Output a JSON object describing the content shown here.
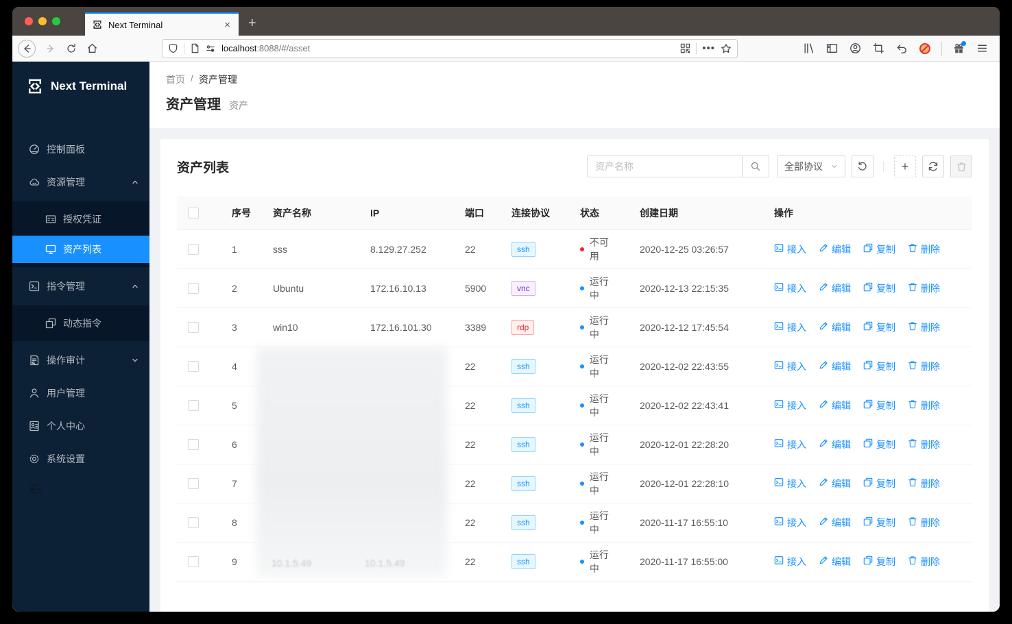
{
  "browser": {
    "tab_title": "Next Terminal",
    "url_host": "localhost",
    "url_rest": ":8088/#/asset",
    "new_tab_label": "+",
    "close_tab_label": "×"
  },
  "sidebar": {
    "logo_text": "Next Terminal",
    "items": [
      {
        "label": "控制面板",
        "icon": "dashboard"
      },
      {
        "label": "资源管理",
        "icon": "cloud",
        "caret": "up"
      },
      {
        "label": "授权凭证",
        "icon": "idcard",
        "submenu": true
      },
      {
        "label": "资产列表",
        "icon": "desktop",
        "submenu": true,
        "selected": true
      },
      {
        "label": "指令管理",
        "icon": "code",
        "caret": "up"
      },
      {
        "label": "动态指令",
        "icon": "block",
        "submenu": true
      },
      {
        "label": "操作审计",
        "icon": "audit",
        "caret": "down"
      },
      {
        "label": "用户管理",
        "icon": "user"
      },
      {
        "label": "个人中心",
        "icon": "solution"
      },
      {
        "label": "系统设置",
        "icon": "setting"
      }
    ]
  },
  "breadcrumb": {
    "home": "首页",
    "separator": "/",
    "current": "资产管理"
  },
  "page": {
    "title": "资产管理",
    "subtitle": "资产"
  },
  "card": {
    "title": "资产列表",
    "search_placeholder": "资产名称",
    "protocol_filter_value": "全部协议"
  },
  "table": {
    "columns": [
      "序号",
      "资产名称",
      "IP",
      "端口",
      "连接协议",
      "状态",
      "创建日期",
      "操作"
    ],
    "action_labels": [
      "接入",
      "编辑",
      "复制",
      "删除"
    ],
    "rows": [
      {
        "no": "1",
        "name": "sss",
        "ip": "8.129.27.252",
        "port": "22",
        "protocol": "ssh",
        "status": "不可用",
        "status_type": "error",
        "date": "2020-12-25 03:26:57",
        "blurred": false
      },
      {
        "no": "2",
        "name": "Ubuntu",
        "ip": "172.16.10.13",
        "port": "5900",
        "protocol": "vnc",
        "status": "运行中",
        "status_type": "running",
        "date": "2020-12-13 22:15:35",
        "blurred": false
      },
      {
        "no": "3",
        "name": "win10",
        "ip": "172.16.101.30",
        "port": "3389",
        "protocol": "rdp",
        "status": "运行中",
        "status_type": "running",
        "date": "2020-12-12 17:45:54",
        "blurred": false
      },
      {
        "no": "4",
        "name": "",
        "ip": "",
        "port": "22",
        "protocol": "ssh",
        "status": "运行中",
        "status_type": "running",
        "date": "2020-12-02 22:43:55",
        "blurred": true
      },
      {
        "no": "5",
        "name": "",
        "ip": "",
        "port": "22",
        "protocol": "ssh",
        "status": "运行中",
        "status_type": "running",
        "date": "2020-12-02 22:43:41",
        "blurred": true
      },
      {
        "no": "6",
        "name": "",
        "ip": "",
        "port": "22",
        "protocol": "ssh",
        "status": "运行中",
        "status_type": "running",
        "date": "2020-12-01 22:28:20",
        "blurred": true
      },
      {
        "no": "7",
        "name": "",
        "ip": "",
        "port": "22",
        "protocol": "ssh",
        "status": "运行中",
        "status_type": "running",
        "date": "2020-12-01 22:28:10",
        "blurred": true
      },
      {
        "no": "8",
        "name": "",
        "ip": "",
        "port": "22",
        "protocol": "ssh",
        "status": "运行中",
        "status_type": "running",
        "date": "2020-11-17 16:55:10",
        "blurred": true
      },
      {
        "no": "9",
        "name": "",
        "ip": "",
        "port": "22",
        "protocol": "ssh",
        "status": "运行中",
        "status_type": "running",
        "date": "2020-11-17 16:55:00",
        "blurred": true
      }
    ],
    "blur_hint": "10.1.5.49"
  },
  "colors": {
    "accent_blue": "#1890ff",
    "sidebar_bg": "#0d2136",
    "submenu_bg": "#071629",
    "status_error": "#f5222d",
    "status_running": "#1890ff",
    "ssh_badge_text": "#1890ff",
    "vnc_badge_text": "#722ed1",
    "rdp_badge_text": "#f5222d",
    "tab_stripe": "#0a84ff"
  }
}
